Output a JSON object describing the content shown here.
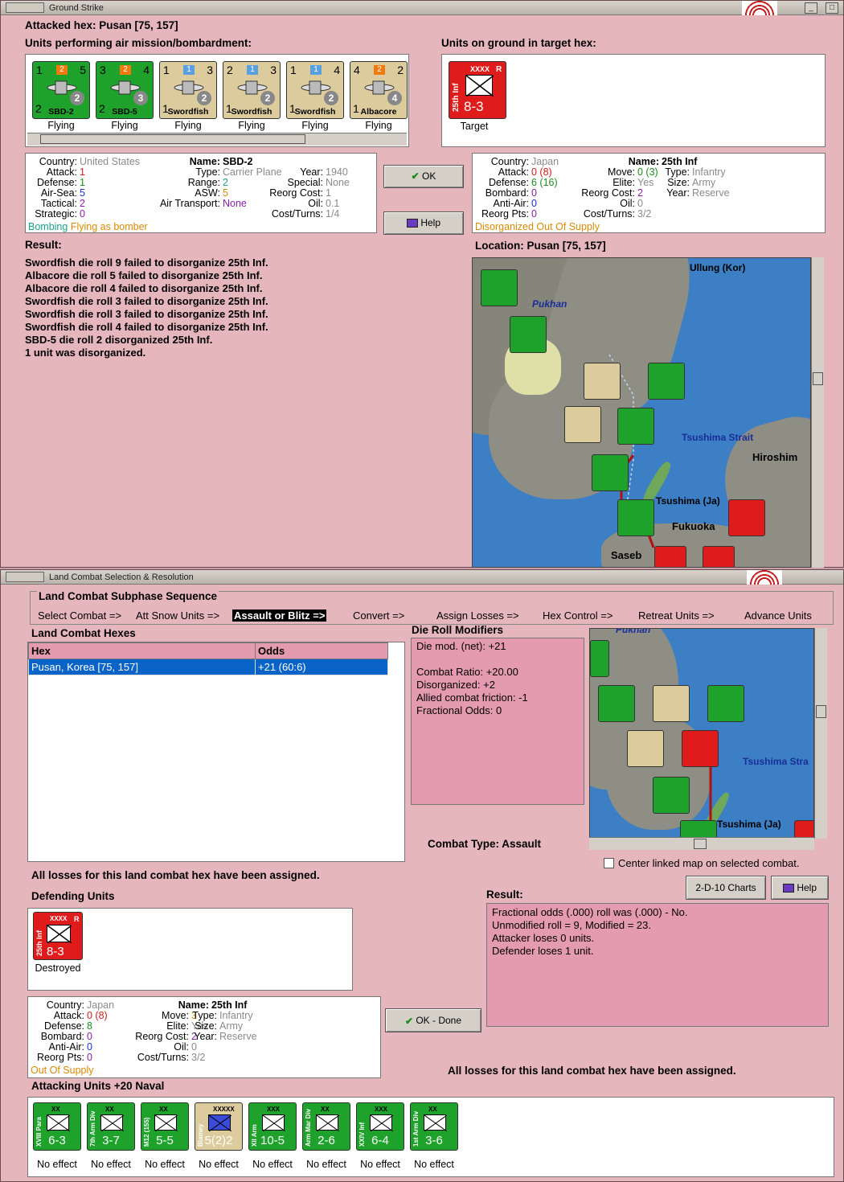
{
  "ground_strike": {
    "title": "Ground Strike",
    "attacked_hex": "Attacked hex: Pusan  [75, 157]",
    "air_units_label": "Units performing air mission/bombardment:",
    "ground_units_label": "Units on ground in target hex:",
    "air_units": [
      {
        "name": "SBD-2",
        "tl": "1",
        "tr": "5",
        "bl": "2",
        "circle": "2",
        "sq": "2",
        "sqcolor": "#f07a10",
        "color": "green",
        "status": "Flying"
      },
      {
        "name": "SBD-5",
        "tl": "3",
        "tr": "4",
        "bl": "2",
        "circle": "3",
        "sq": "2",
        "sqcolor": "#f07a10",
        "color": "green",
        "status": "Flying"
      },
      {
        "name": "Swordfish",
        "tl": "1",
        "tr": "3",
        "bl": "1",
        "circle": "2",
        "sq": "1",
        "sqcolor": "#5aa0e0",
        "color": "tan",
        "status": "Flying"
      },
      {
        "name": "Swordfish",
        "tl": "2",
        "tr": "3",
        "bl": "1",
        "circle": "2",
        "sq": "1",
        "sqcolor": "#5aa0e0",
        "color": "tan",
        "status": "Flying"
      },
      {
        "name": "Swordfish",
        "tl": "1",
        "tr": "4",
        "bl": "1",
        "circle": "2",
        "sq": "1",
        "sqcolor": "#5aa0e0",
        "color": "tan",
        "status": "Flying"
      },
      {
        "name": "Albacore",
        "tl": "4",
        "tr": "2",
        "bl": "1",
        "circle": "4",
        "sq": "2",
        "sqcolor": "#f07a10",
        "color": "tan",
        "status": "Flying"
      }
    ],
    "target": {
      "side": "25th Inf",
      "size": "XXXX",
      "tag": "R",
      "strength": "8-3",
      "status": "Target"
    },
    "air_info": {
      "country_k": "Country:",
      "country": "United States",
      "attack_k": "Attack:",
      "attack": "1",
      "defense_k": "Defense:",
      "defense": "1",
      "airsea_k": "Air-Sea:",
      "airsea": "5",
      "tactical_k": "Tactical:",
      "tactical": "2",
      "strategic_k": "Strategic:",
      "strategic": "0",
      "name_k": "Name:",
      "name": "SBD-2",
      "type_k": "Type:",
      "type": "Carrier Plane",
      "year_k": "Year:",
      "year": "1940",
      "range_k": "Range:",
      "range": "2",
      "special_k": "Special:",
      "special": "None",
      "asw_k": "ASW:",
      "asw": "5",
      "reorg_k": "Reorg Cost:",
      "reorg": "1",
      "airtrans_k": "Air Transport:",
      "airtrans": "None",
      "oil_k": "Oil:",
      "oil": "0.1",
      "cost_k": "Cost/Turns:",
      "cost": "1/4",
      "mission1": "Bombing",
      "mission2": "Flying as bomber"
    },
    "ok_label": "OK",
    "help_label": "Help",
    "target_info": {
      "country_k": "Country:",
      "country": "Japan",
      "attack_k": "Attack:",
      "attack": "0 (8)",
      "defense_k": "Defense:",
      "defense": "6 (16)",
      "bombard_k": "Bombard:",
      "bombard": "0",
      "antiair_k": "Anti-Air:",
      "antiair": "0",
      "reorgpts_k": "Reorg Pts:",
      "reorgpts": "0",
      "name_k": "Name:",
      "name": "25th Inf",
      "move_k": "Move:",
      "move": "0 (3)",
      "type_k": "Type:",
      "type": "Infantry",
      "elite_k": "Elite:",
      "elite": "Yes",
      "size_k": "Size:",
      "size": "Army",
      "reorg_k": "Reorg Cost:",
      "reorg": "2",
      "year_k": "Year:",
      "year": "Reserve",
      "oil_k": "Oil:",
      "oil": "0",
      "cost_k": "Cost/Turns:",
      "cost": "3/2",
      "status": "Disorganized Out Of Supply"
    },
    "result_label": "Result:",
    "results": [
      "Swordfish die roll 9 failed to disorganize 25th Inf.",
      "Albacore die roll 5 failed to disorganize 25th Inf.",
      "Albacore die roll 4 failed to disorganize 25th Inf.",
      "Swordfish die roll 3 failed to disorganize 25th Inf.",
      "Swordfish die roll 3 failed to disorganize 25th Inf.",
      "Swordfish die roll 4 failed to disorganize 25th Inf.",
      "SBD-5 die roll 2 disorganized 25th Inf.",
      "1 unit was disorganized."
    ],
    "location": "Location:  Pusan  [75, 157]",
    "map_labels": {
      "ullung": "Ullung (Kor)",
      "pukhan": "Pukhan",
      "tsushima_strait": "Tsushima Strait",
      "hiroshima": "Hiroshim",
      "tsushima": "Tsushima (Ja)",
      "fukuoka": "Fukuoka",
      "sasebo": "Saseb"
    }
  },
  "land_combat": {
    "title": "Land Combat Selection & Resolution",
    "sequence_label": "Land Combat Subphase Sequence",
    "phases": [
      "Select Combat =>",
      "Att Snow Units =>",
      "Assault or Blitz =>",
      "Convert =>",
      "Assign Losses =>",
      "Hex Control =>",
      "Retreat Units =>",
      "Advance Units"
    ],
    "hexes_label": "Land Combat Hexes",
    "col_hex": "Hex",
    "col_odds": "Odds",
    "rows": [
      {
        "hex": "Pusan, Korea [75, 157]",
        "odds": "+21 (60:6)"
      }
    ],
    "modifiers_label": "Die Roll Modifiers",
    "modifiers": [
      "Die mod. (net): +21",
      "",
      "Combat Ratio: +20.00",
      "Disorganized: +2",
      "Allied combat friction: -1",
      "Fractional Odds: 0"
    ],
    "combat_type": "Combat Type:  Assault",
    "center_map": "Center linked map on selected combat.",
    "losses_msg": "All losses for this land combat hex have been assigned.",
    "charts_btn": "2-D-10 Charts",
    "help_btn": "Help",
    "defending_label": "Defending Units",
    "defender": {
      "side": "25th Inf",
      "size": "XXXX",
      "tag": "R",
      "strength": "8-3",
      "status": "Destroyed"
    },
    "result_label": "Result:",
    "results": [
      "Fractional odds (.000) roll was (.000)  - No.",
      "Unmodified roll = 9, Modified = 23.",
      "Attacker loses 0 units.",
      "Defender loses 1 unit."
    ],
    "def_info": {
      "country_k": "Country:",
      "country": "Japan",
      "attack_k": "Attack:",
      "attack": "0 (8)",
      "defense_k": "Defense:",
      "defense": "8",
      "bombard_k": "Bombard:",
      "bombard": "0",
      "antiair_k": "Anti-Air:",
      "antiair": "0",
      "reorgpts_k": "Reorg Pts:",
      "reorgpts": "0",
      "name_k": "Name:",
      "name": "25th Inf",
      "move_k": "Move:",
      "move": "3",
      "type_k": "Type:",
      "type": "Infantry",
      "elite_k": "Elite:",
      "elite": "Yes",
      "size_k": "Size:",
      "size": "Army",
      "reorg_k": "Reorg Cost:",
      "reorg": "2",
      "year_k": "Year:",
      "year": "Reserve",
      "oil_k": "Oil:",
      "oil": "0",
      "cost_k": "Cost/Turns:",
      "cost": "3/2",
      "status": "Out Of Supply"
    },
    "ok_done": "OK - Done",
    "losses_msg2": "All losses for this land combat hex have been assigned.",
    "attacking_label": "Attacking Units +20 Naval",
    "attackers": [
      {
        "side": "XVIII Para",
        "size": "XX",
        "strength": "6-3",
        "color": "green",
        "status": "No effect"
      },
      {
        "side": "7th Arm Div",
        "size": "XX",
        "strength": "3-7",
        "color": "green",
        "status": "No effect"
      },
      {
        "side": "M12 (155)",
        "size": "XX",
        "strength": "5-5",
        "color": "green",
        "status": "No effect"
      },
      {
        "side": "Blamey",
        "size": "XXXXX",
        "strength": "5(2)2",
        "color": "tan",
        "status": "No effect"
      },
      {
        "side": "XII Arm",
        "size": "XXX",
        "strength": "10-5",
        "color": "green",
        "status": "No effect"
      },
      {
        "side": "Arm Mar Div",
        "size": "XX",
        "strength": "2-6",
        "color": "green",
        "status": "No effect"
      },
      {
        "side": "XXIV Inf",
        "size": "XXX",
        "strength": "6-4",
        "color": "green",
        "status": "No effect"
      },
      {
        "side": "1st Arm Div",
        "size": "XX",
        "strength": "3-6",
        "color": "green",
        "status": "No effect"
      }
    ],
    "map_labels": {
      "tsushima_strait": "Tsushima Stra",
      "tsushima": "Tsushima (Ja)",
      "pukhan": "Pukhan"
    }
  },
  "colors": {
    "window": "#e6b6bd",
    "pink_panel": "#e49ab0",
    "selection": "#0a64c8",
    "green_counter": "#1fa22b",
    "red_counter": "#e01b1b"
  }
}
